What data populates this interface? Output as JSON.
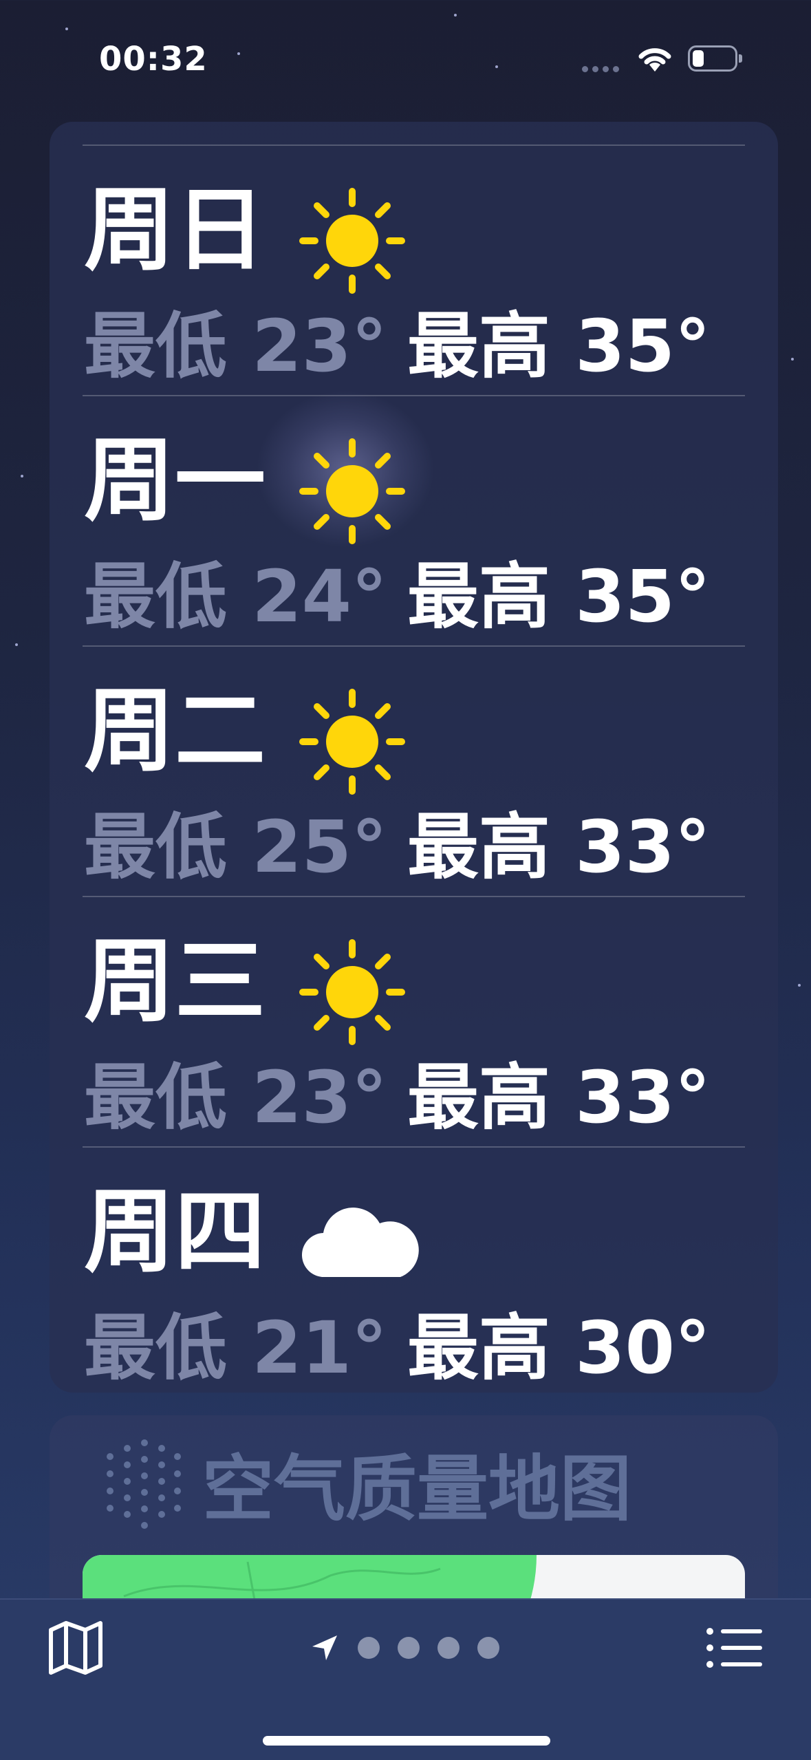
{
  "status_bar": {
    "time": "00:32"
  },
  "forecast": [
    {
      "day": "周日",
      "icon": "sun-icon",
      "low": "最低 23°",
      "high": "最高 35°"
    },
    {
      "day": "周一",
      "icon": "sun-icon",
      "low": "最低 24°",
      "high": "最高 35°"
    },
    {
      "day": "周二",
      "icon": "sun-icon",
      "low": "最低 25°",
      "high": "最高 33°"
    },
    {
      "day": "周三",
      "icon": "sun-icon",
      "low": "最低 23°",
      "high": "最高 33°"
    },
    {
      "day": "周四",
      "icon": "cloud-icon",
      "low": "最低 21°",
      "high": "最高 30°"
    }
  ],
  "air_quality": {
    "title": "空气质量地图",
    "icon": "air-quality-dots-icon"
  },
  "toolbar": {
    "map_icon": "map-icon",
    "location_icon": "location-arrow-icon",
    "list_icon": "list-icon",
    "page_count": 4
  },
  "colors": {
    "sun": "#FFD60A",
    "map_green": "#5BE07C",
    "low_text": "#7E86A7"
  }
}
